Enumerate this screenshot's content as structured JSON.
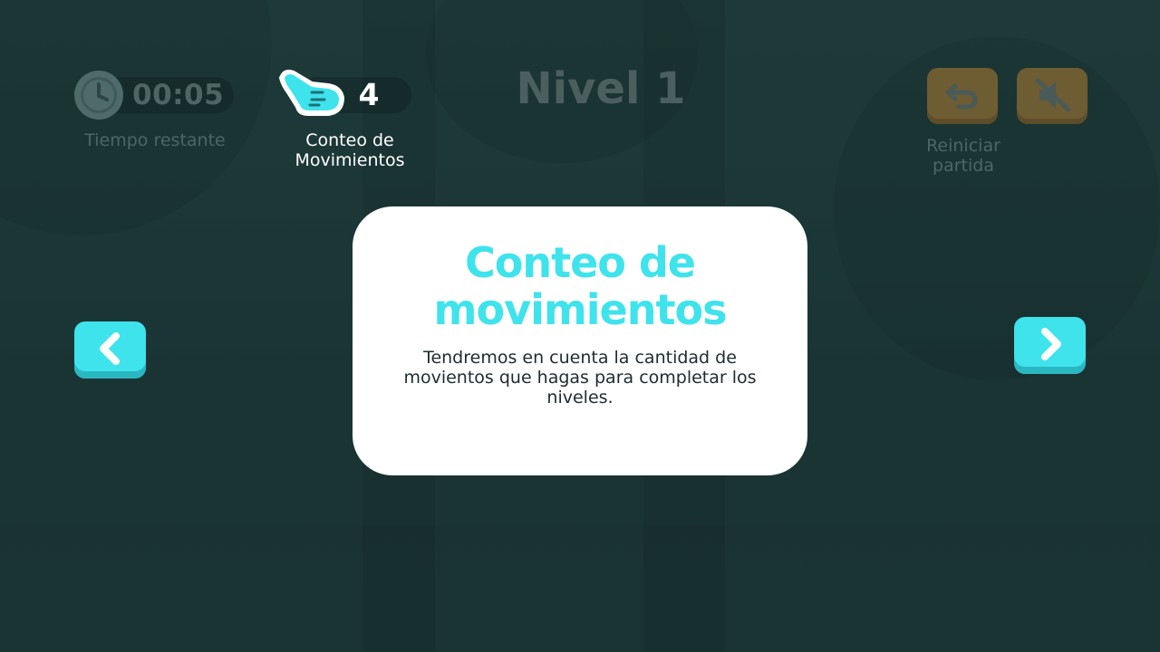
{
  "hud": {
    "timer": {
      "value": "00:05",
      "label": "Tiempo restante",
      "icon": "clock-icon"
    },
    "moves": {
      "value": "4",
      "label": "Conteo de Movimientos",
      "icon": "tap-hand-icon"
    },
    "level_title": "Nivel 1"
  },
  "buttons": {
    "restart": {
      "icon": "undo-arrow-icon",
      "label": "Reiniciar partida"
    },
    "mute": {
      "icon": "speaker-muted-icon"
    },
    "prev": {
      "icon": "chevron-left-icon"
    },
    "next": {
      "icon": "chevron-right-icon"
    }
  },
  "card": {
    "title": "Conteo de movimientos",
    "text": "Tendremos en cuenta la cantidad de movientos que hagas para completar los niveles."
  },
  "colors": {
    "accent_cyan": "#3ee3ec",
    "button_dim_orange": "#6e5c33",
    "background": "#1c3636",
    "card": "#ffffff"
  }
}
